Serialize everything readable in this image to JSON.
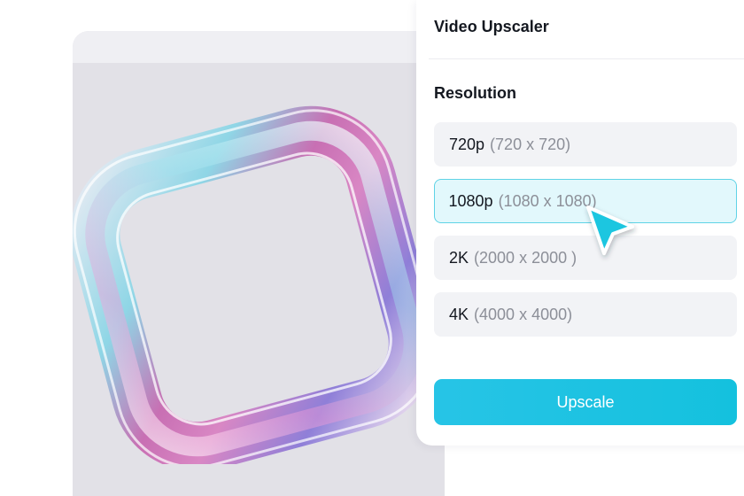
{
  "panel": {
    "title": "Video Upscaler",
    "resolution_label": "Resolution",
    "options": [
      {
        "name": "720p",
        "dims": "(720 x 720)",
        "selected": false
      },
      {
        "name": "1080p",
        "dims": "(1080 x 1080)",
        "selected": true
      },
      {
        "name": "2K",
        "dims": "(2000 x 2000 )",
        "selected": false
      },
      {
        "name": "4K",
        "dims": "(4000 x 4000)",
        "selected": false
      }
    ],
    "upscale_label": "Upscale"
  },
  "icons": {
    "cursor": "mouse-pointer-icon"
  },
  "colors": {
    "accent": "#14c1de",
    "selected_bg": "#e2f8fc",
    "selected_border": "#5fd3e6",
    "option_bg": "#f2f3f6",
    "preview_bg": "#e2e1e7"
  }
}
